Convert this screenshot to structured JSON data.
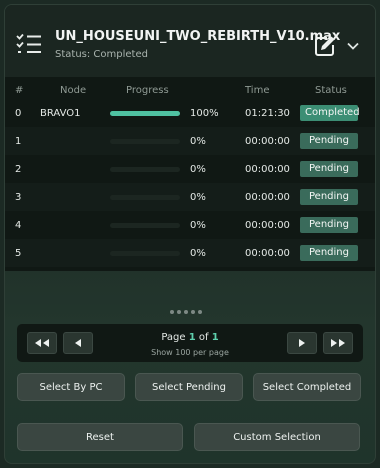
{
  "header": {
    "title": "UN_HOUSEUNI_TWO_REBIRTH_V10.max",
    "status": "Status: Completed",
    "icons": {
      "list": "checklist-icon",
      "edit": "edit-icon",
      "toggle": "chevron-down-icon"
    }
  },
  "table": {
    "columns": [
      "#",
      "Node",
      "Progress",
      "Time",
      "Status"
    ],
    "rows": [
      {
        "index": "0",
        "node": "BRAVO1",
        "progress": 1.0,
        "progress_label": "100%",
        "time": "01:21:30",
        "status": "Completed"
      },
      {
        "index": "1",
        "node": "",
        "progress": 0.0,
        "progress_label": "0%",
        "time": "00:00:00",
        "status": "Pending"
      },
      {
        "index": "2",
        "node": "",
        "progress": 0.0,
        "progress_label": "0%",
        "time": "00:00:00",
        "status": "Pending"
      },
      {
        "index": "3",
        "node": "",
        "progress": 0.0,
        "progress_label": "0%",
        "time": "00:00:00",
        "status": "Pending"
      },
      {
        "index": "4",
        "node": "",
        "progress": 0.0,
        "progress_label": "0%",
        "time": "00:00:00",
        "status": "Pending"
      },
      {
        "index": "5",
        "node": "",
        "progress": 0.0,
        "progress_label": "0%",
        "time": "00:00:00",
        "status": "Pending"
      }
    ]
  },
  "pagination": {
    "page_word": "Page",
    "current": "1",
    "of_word": "of",
    "total": "1",
    "per_page": "Show 100 per page",
    "first_symbol": "◀◀",
    "prev_symbol": "◀",
    "next_symbol": "▶",
    "last_symbol": "▶▶"
  },
  "buttons": {
    "select_by_pc": "Select By PC",
    "select_pending": "Select Pending",
    "select_completed": "Select Completed",
    "reset": "Reset",
    "custom_selection": "Custom Selection"
  },
  "colors": {
    "accent": "#4fc1a1",
    "completed_badge": "#3c8e74",
    "pending_badge": "#3a6b5b"
  }
}
